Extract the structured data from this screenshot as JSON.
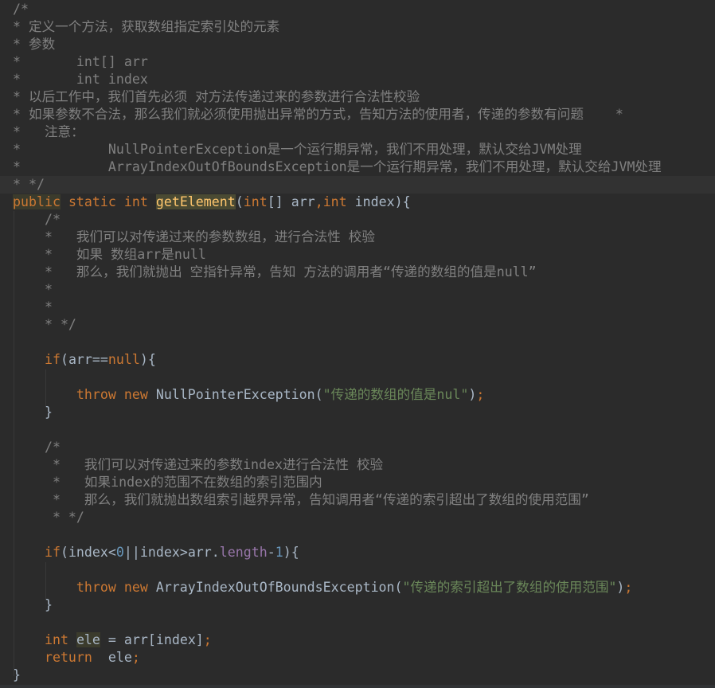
{
  "editor": {
    "current_line": 11,
    "lines": [
      [
        [
          "c",
          "/*"
        ]
      ],
      [
        [
          "c",
          "* 定义一个方法，获取数组指定索引处的元素"
        ]
      ],
      [
        [
          "c",
          "* 参数"
        ]
      ],
      [
        [
          "c",
          "*       int[] arr"
        ]
      ],
      [
        [
          "c",
          "*       int index"
        ]
      ],
      [
        [
          "c",
          "* 以后工作中，我们首先必须 对方法传递过来的参数进行合法性校验"
        ]
      ],
      [
        [
          "c",
          "* 如果参数不合法，那么我们就必须使用抛出异常的方式，告知方法的使用者，传递的参数有问题    *"
        ]
      ],
      [
        [
          "c",
          "*   注意："
        ]
      ],
      [
        [
          "c",
          "*           NullPointerException是一个运行期异常，我们不用处理，默认交给JVM处理"
        ]
      ],
      [
        [
          "c",
          "*           ArrayIndexOutOfBoundsException是一个运行期异常，我们不用处理，默认交给JVM处理"
        ]
      ],
      [
        [
          "c",
          "* */"
        ]
      ],
      [
        [
          "k hl",
          "public"
        ],
        [
          "k",
          " static int "
        ],
        [
          "m hlm",
          "getElement"
        ],
        [
          "i",
          "("
        ],
        [
          "k",
          "int"
        ],
        [
          "i",
          "[] arr"
        ],
        [
          "p",
          ","
        ],
        [
          "k",
          "int"
        ],
        [
          "i",
          " index){"
        ]
      ],
      [
        [
          "c",
          "    /*"
        ]
      ],
      [
        [
          "c",
          "    *   我们可以对传递过来的参数数组，进行合法性 校验"
        ]
      ],
      [
        [
          "c",
          "    *   如果 数组arr是null"
        ]
      ],
      [
        [
          "c",
          "    *   那么，我们就抛出 空指针异常，告知 方法的调用者“传递的数组的值是null”"
        ]
      ],
      [
        [
          "c",
          "    *"
        ]
      ],
      [
        [
          "c",
          "    *"
        ]
      ],
      [
        [
          "c",
          "    * */"
        ]
      ],
      [],
      [
        [
          "k",
          "    if"
        ],
        [
          "i",
          "(arr=="
        ],
        [
          "k",
          "null"
        ],
        [
          "i",
          "){"
        ]
      ],
      [],
      [
        [
          "k",
          "        throw new "
        ],
        [
          "i",
          "NullPointerException("
        ],
        [
          "s",
          "\"传递的数组的值是nul\""
        ],
        [
          "i",
          ")"
        ],
        [
          "p",
          ";"
        ]
      ],
      [
        [
          "i",
          "    }"
        ]
      ],
      [],
      [
        [
          "c",
          "    /*"
        ]
      ],
      [
        [
          "c",
          "     *   我们可以对传递过来的参数index进行合法性 校验"
        ]
      ],
      [
        [
          "c",
          "     *   如果index的范围不在数组的索引范围内"
        ]
      ],
      [
        [
          "c",
          "     *   那么，我们就抛出数组索引越界异常，告知调用者“传递的索引超出了数组的使用范围”"
        ]
      ],
      [
        [
          "c",
          "     * */"
        ]
      ],
      [],
      [
        [
          "k",
          "    if"
        ],
        [
          "i",
          "(index<"
        ],
        [
          "n",
          "0"
        ],
        [
          "i",
          "||index>arr."
        ],
        [
          "f",
          "length"
        ],
        [
          "i",
          "-"
        ],
        [
          "n",
          "1"
        ],
        [
          "i",
          "){"
        ]
      ],
      [],
      [
        [
          "k",
          "        throw new "
        ],
        [
          "i",
          "ArrayIndexOutOfBoundsException("
        ],
        [
          "s",
          "\"传递的索引超出了数组的使用范围\""
        ],
        [
          "i",
          ")"
        ],
        [
          "p",
          ";"
        ]
      ],
      [
        [
          "i",
          "    }"
        ]
      ],
      [],
      [
        [
          "k",
          "    int "
        ],
        [
          "i hl",
          "ele"
        ],
        [
          "i",
          " = arr[index]"
        ],
        [
          "p",
          ";"
        ]
      ],
      [
        [
          "k",
          "    return  "
        ],
        [
          "i",
          "ele"
        ],
        [
          "p",
          ";"
        ]
      ],
      [
        [
          "i",
          "}"
        ]
      ]
    ]
  }
}
